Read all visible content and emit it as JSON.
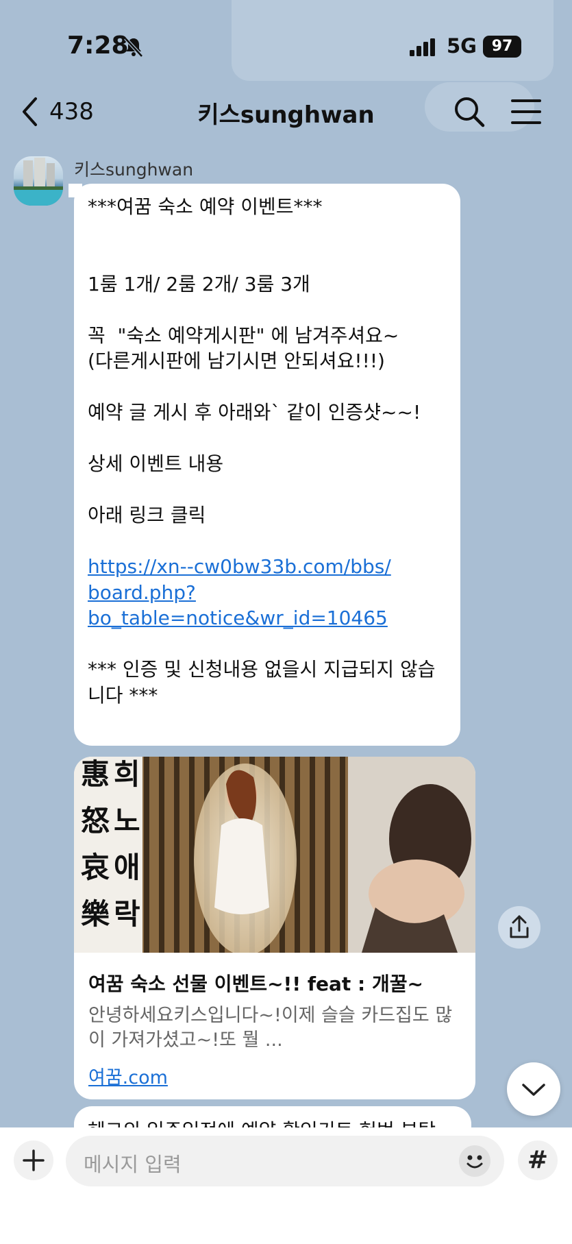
{
  "status_bar": {
    "time": "7:28",
    "network": "5G",
    "battery": "97"
  },
  "header": {
    "back_count": "438",
    "title": "키스sunghwan"
  },
  "message": {
    "sender": "키스sunghwan",
    "text_before_link": "***여꿈 숙소 예약 이벤트***\n\n\n1룸 1개/ 2룸 2개/ 3룸 3개\n\n꼭  \"숙소 예약게시판\" 에 남겨주셔요~\n(다른게시판에 남기시면 안되셔요!!!)\n\n예약 글 게시 후 아래와` 같이 인증샷~~!\n\n상세 이벤트 내용\n\n아래 링크 클릭\n\n",
    "link": "https://xn--cw0bw33b.com/bbs/\nboard.php?\nbo_table=notice&wr_id=10465",
    "text_after_link": "\n\n*** 인증 및 신청내용 없을시 지급되지 않습\n니다 ***"
  },
  "link_preview": {
    "image_caption": "희노애락",
    "title": "여꿈 숙소 선물 이벤트~!! feat : 개꿀~",
    "description": "안녕하세요키스입니다~!이제 슬슬 카드집도 많이 가져가셨고~!또 뭘 ...",
    "domain": "여꿈.com"
  },
  "next_message_partial": "헤그의 입주입전에 예약 확인키트 헌번 부탁",
  "input": {
    "placeholder": "메시지 입력",
    "hash_label": "#"
  },
  "icons": {
    "back": "chevron-left-icon",
    "search": "search-icon",
    "menu": "hamburger-menu-icon",
    "share": "share-icon",
    "scroll_down": "chevron-down-icon",
    "plus": "plus-icon",
    "emoji": "emoji-icon",
    "bell_muted": "bell-slash-icon"
  },
  "colors": {
    "chat_background": "#a9bed3",
    "link": "#1a6fd6"
  }
}
